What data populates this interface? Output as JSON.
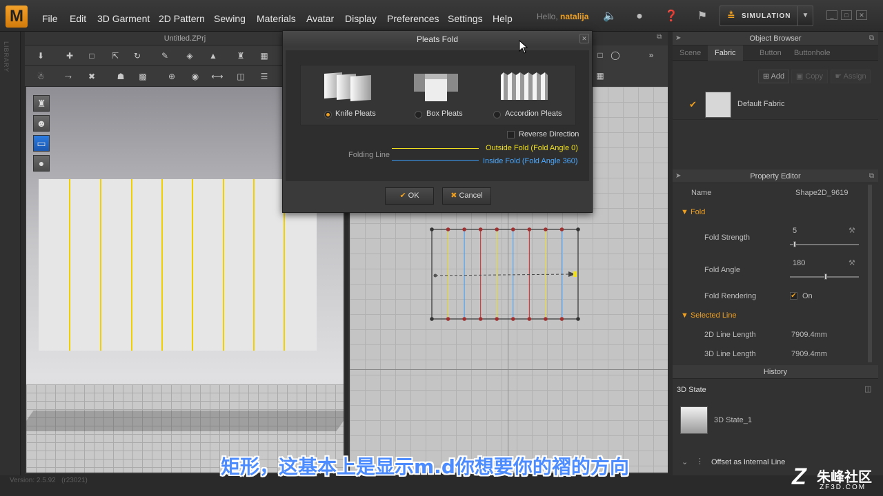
{
  "app": {
    "logo": "M",
    "menu": [
      "File",
      "Edit",
      "3D Garment",
      "2D Pattern",
      "Sewing",
      "Materials",
      "Avatar",
      "Display",
      "Preferences",
      "Settings",
      "Help"
    ],
    "hello_prefix": "Hello,",
    "user": "natalija",
    "simulation_label": "SIMULATION"
  },
  "left_strip": {
    "label": "LIBRARY"
  },
  "window3d": {
    "title": "Untitled.ZPrj"
  },
  "dialog": {
    "title": "Pleats Fold",
    "types": [
      {
        "label": "Knife Pleats",
        "selected": true
      },
      {
        "label": "Box Pleats",
        "selected": false
      },
      {
        "label": "Accordion Pleats",
        "selected": false
      }
    ],
    "reverse_direction": "Reverse Direction",
    "folding_line_label": "Folding Line",
    "outside_fold": "Outside Fold (Fold Angle 0)",
    "inside_fold": "Inside Fold (Fold Angle 360)",
    "ok": "OK",
    "cancel": "Cancel",
    "colors": {
      "outside": "#f0e020",
      "inside": "#3ca0ff",
      "accent": "#f0a020"
    }
  },
  "object_browser": {
    "title": "Object Browser",
    "tabs": [
      "Scene",
      "Fabric",
      "Button",
      "Buttonhole"
    ],
    "active_tab": "Fabric",
    "buttons": {
      "add": "Add",
      "copy": "Copy",
      "assign": "Assign"
    },
    "fabric_item": "Default Fabric"
  },
  "property_editor": {
    "title": "Property Editor",
    "name_key": "Name",
    "name_value": "Shape2D_9619",
    "fold_section": "Fold",
    "fold_strength_key": "Fold Strength",
    "fold_strength_value": "5",
    "fold_strength_level": 0.05,
    "fold_angle_key": "Fold Angle",
    "fold_angle_value": "180",
    "fold_angle_level": 0.5,
    "fold_rendering_key": "Fold Rendering",
    "fold_rendering_value": "On",
    "selected_line_section": "Selected Line",
    "line2d_key": "2D Line Length",
    "line2d_value": "7909.4mm",
    "line3d_key": "3D Line Length",
    "line3d_value": "7909.4mm"
  },
  "history": {
    "title": "History",
    "state_label": "3D State",
    "item": "3D State_1",
    "offset_item": "Offset as Internal Line"
  },
  "status": {
    "version": "Version: 2.5.92",
    "revision": "(r23021)"
  },
  "subtitle": "矩形，这基本上是显示m.d你想要你的褶的方向",
  "watermark": {
    "name": "朱峰社区",
    "url": "ZF3D.COM",
    "logo": "Z"
  },
  "pattern2d": {
    "line_colors": [
      "#f0e020",
      "#3ca0ff",
      "#cc2a2a"
    ]
  }
}
